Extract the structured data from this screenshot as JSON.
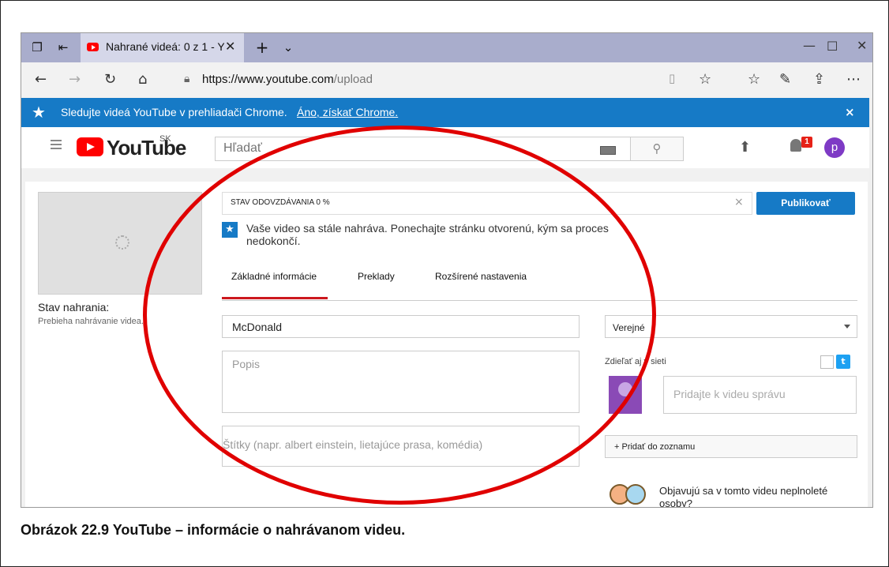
{
  "browser": {
    "tab_title": "Nahrané videá: 0 z 1 - Y",
    "url_host": "https://www.youtube.com",
    "url_path": "/upload",
    "icons": [
      "tabs-icon",
      "back-tab-icon",
      "new-tab-icon",
      "chevron-down-icon",
      "minimize-icon",
      "maximize-icon",
      "close-icon",
      "back-icon",
      "forward-icon",
      "refresh-icon",
      "home-icon",
      "lock-icon",
      "reading-view-icon",
      "favorite-icon",
      "favorites-hub-icon",
      "pen-icon",
      "share-icon",
      "more-icon"
    ]
  },
  "banner": {
    "text": "Sledujte videá YouTube v prehliadači Chrome.",
    "link": "Áno, získať Chrome.",
    "close": "×",
    "color": "#167ac6"
  },
  "header": {
    "logo_text": "YouTube",
    "region": "SK",
    "search_placeholder": "Hľadať",
    "notification_count": "1",
    "avatar_letter": "p"
  },
  "upload": {
    "thumbnail_status_label": "Stav nahrania:",
    "thumbnail_status_value": "Prebieha nahrávanie videa.",
    "progress_label": "STAV ODOVZDÁVANIA 0 %",
    "publish_label": "Publikovať",
    "info_message": "Vaše video sa stále nahráva. Ponechajte stránku otvorenú, kým sa proces nedokončí.",
    "tabs": [
      {
        "label": "Základné informácie",
        "active": true
      },
      {
        "label": "Preklady",
        "active": false
      },
      {
        "label": "Rozšírené nastavenia",
        "active": false
      }
    ],
    "title_value": "McDonald",
    "description_placeholder": "Popis",
    "tags_placeholder": "Štítky (napr. albert einstein, lietajúce prasa, komédia)",
    "visibility_value": "Verejné",
    "share_label": "Zdieľať aj v sieti",
    "share_message_placeholder": "Pridajte k videu správu",
    "playlist_label": "+ Pridať do zoznamu",
    "minors_question": "Objavujú sa v tomto videu neplnoleté osoby?"
  },
  "caption": "Obrázok 22.9 YouTube – informácie o nahrávanom videu.",
  "colors": {
    "accent_red": "#cc181e",
    "highlight_ellipse": "#e00000",
    "youtube_red": "#ff0000"
  }
}
